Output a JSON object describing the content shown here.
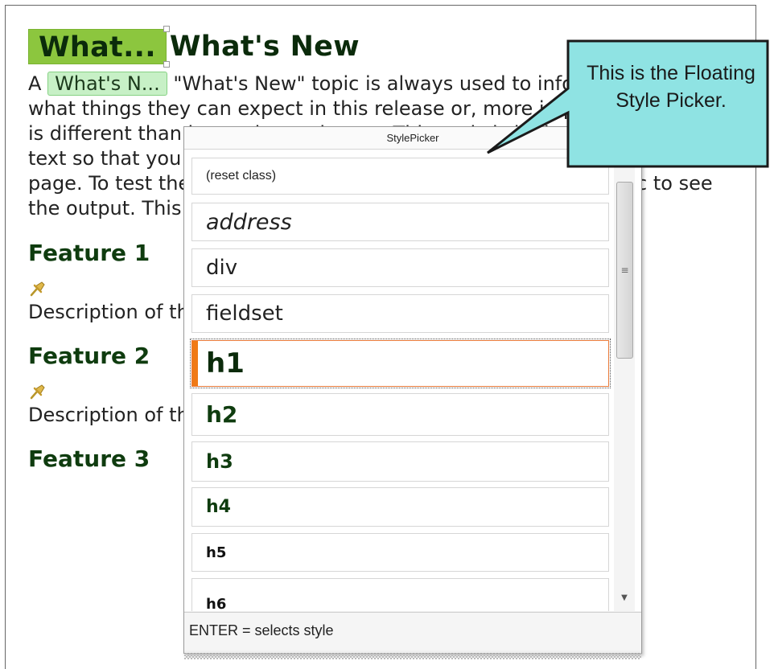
{
  "document": {
    "h1_tag": "What...",
    "title": "What's New",
    "p_tag": "What's N...",
    "paragraph_text": "\"What's New\" topic is always used to inform users of what things they can expect in this release or, more importantly, what is different than in previous releases. This topic is built using drop-down text so that you can fit lots of information into a small space on the page. To test the drop-down text, go to the View Compiled Topic to see the output. This will generate a preview of the topic.",
    "paragraph_prefix": "A",
    "sections": [
      {
        "heading": "Feature 1",
        "description": "Description of the feature."
      },
      {
        "heading": "Feature 2",
        "description": "Description of the feature."
      },
      {
        "heading": "Feature 3"
      }
    ]
  },
  "style_picker": {
    "title": "StylePicker",
    "items": [
      {
        "label": "(reset class)"
      },
      {
        "label": "address"
      },
      {
        "label": "div"
      },
      {
        "label": "fieldset"
      },
      {
        "label": "h1",
        "selected": true
      },
      {
        "label": "h2"
      },
      {
        "label": "h3"
      },
      {
        "label": "h4"
      },
      {
        "label": "h5"
      },
      {
        "label": "h6"
      }
    ],
    "status": "ENTER = selects style"
  },
  "callout": {
    "text": "This is the Floating Style Picker."
  },
  "colors": {
    "h1_tag_bg": "#8cc63e",
    "p_tag_bg": "#c7f0c6",
    "callout_fill": "#8fe3e3",
    "selection_accent": "#f07a16",
    "heading_color": "#0f3c0f"
  }
}
